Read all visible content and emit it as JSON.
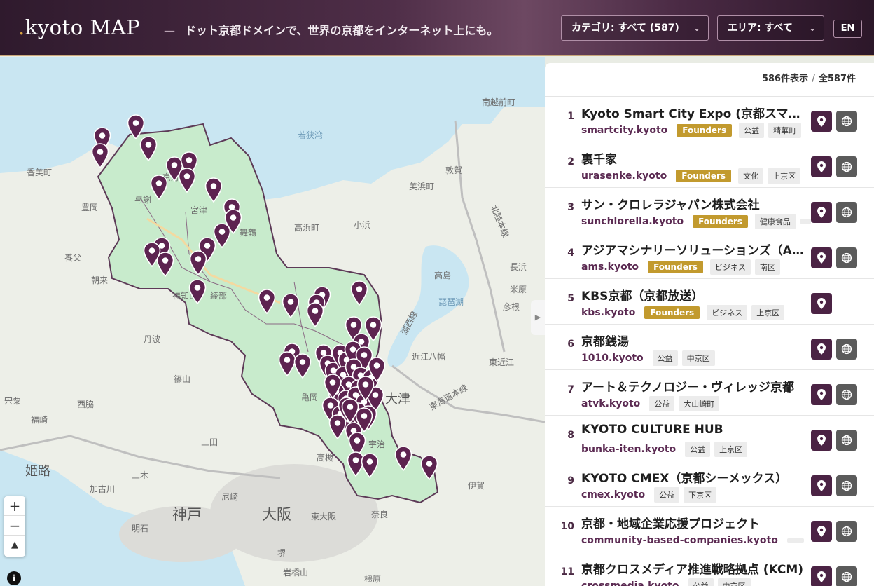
{
  "header": {
    "logo_dot": ".",
    "logo_text": "kyoto MAP",
    "dash": "—",
    "tagline": "ドット京都ドメインで、世界の京都をインターネット上にも。",
    "category_select": "カテゴリ: すべて (587)",
    "area_select": "エリア: すべて",
    "lang_button": "EN"
  },
  "map": {
    "labels": {
      "kasumi": "香美町",
      "toyooka": "豊岡",
      "yabu": "養父",
      "asago": "朝来",
      "tamba": "丹波",
      "sasayama": "篠山",
      "shiso": "宍粟",
      "nishiwaki": "西脇",
      "fukusaki": "福崎",
      "himeji": "姫路",
      "miki": "三木",
      "kakogawa": "加古川",
      "akashi": "明石",
      "kobe": "神戸",
      "sanda": "三田",
      "amagasaki": "尼崎",
      "osaka": "大阪",
      "higashiosaka": "東大阪",
      "nara": "奈良",
      "ikoma_mt": "岩橋山",
      "sakai": "堺",
      "kashihara": "橿原",
      "iga": "伊賀",
      "nagahama": "長浜",
      "takashima": "高島",
      "omihachiman": "近江八幡",
      "higashiomi": "東近江",
      "otsu": "大津",
      "hikone": "彦根",
      "maibara": "米原",
      "tsuruga": "敦賀",
      "mihama": "美浜町",
      "obama": "小浜",
      "takahama": "高浜町",
      "minamiechizen": "南越前町",
      "wakasa_bay": "若狭湾",
      "lake_biwa": "琵琶湖",
      "fukuchiyama": "福知山",
      "ayabe": "綾部",
      "maizuru": "舞鶴",
      "miyazu": "宮津",
      "kyotango": "京丹",
      "yosano": "与謝",
      "kameoka": "亀岡",
      "uji": "宇治",
      "takatsuki": "高槻",
      "kohoku": "北陸本線",
      "biwako_line": "湖西線",
      "tokaido": "東海道本線",
      "road_27": "27",
      "road_e8": "E8",
      "road_e95": "E95",
      "road_e26": "E26",
      "road_28": "28",
      "road_26": "26",
      "road_29": "29"
    },
    "zoom_in": "+",
    "zoom_out": "−",
    "compass": "▲",
    "info": "i",
    "collapse": "▶"
  },
  "panel": {
    "shown": "586件表示",
    "separator": "/",
    "total": "全587件",
    "items": [
      {
        "num": "1",
        "name": "Kyoto Smart City Expo (京都スマートシティエキスポ)",
        "domain": "smartcity.kyoto",
        "founders": "Founders",
        "tags": [
          "公益",
          "精華町"
        ],
        "web": true
      },
      {
        "num": "2",
        "name": "裏千家",
        "domain": "urasenke.kyoto",
        "founders": "Founders",
        "tags": [
          "文化",
          "上京区"
        ],
        "web": true
      },
      {
        "num": "3",
        "name": "サン・クロレラジャパン株式会社",
        "domain": "sunchlorella.kyoto",
        "founders": "Founders",
        "tags": [
          "健康食品",
          ""
        ],
        "web": true
      },
      {
        "num": "4",
        "name": "アジアマシナリーソリューションズ（AMS）",
        "domain": "ams.kyoto",
        "founders": "Founders",
        "tags": [
          "ビジネス",
          "南区"
        ],
        "web": true
      },
      {
        "num": "5",
        "name": "KBS京都（京都放送）",
        "domain": "kbs.kyoto",
        "founders": "Founders",
        "tags": [
          "ビジネス",
          "上京区"
        ],
        "web": false
      },
      {
        "num": "6",
        "name": "京都銭湯",
        "domain": "1010.kyoto",
        "founders": "",
        "tags": [
          "公益",
          "中京区"
        ],
        "web": true
      },
      {
        "num": "7",
        "name": "アート＆テクノロジー・ヴィレッジ京都",
        "domain": "atvk.kyoto",
        "founders": "",
        "tags": [
          "公益",
          "大山崎町"
        ],
        "web": true
      },
      {
        "num": "8",
        "name": "KYOTO CULTURE HUB",
        "domain": "bunka-iten.kyoto",
        "founders": "",
        "tags": [
          "公益",
          "上京区"
        ],
        "web": true
      },
      {
        "num": "9",
        "name": "KYOTO CMEX（京都シーメックス）",
        "domain": "cmex.kyoto",
        "founders": "",
        "tags": [
          "公益",
          "下京区"
        ],
        "web": true
      },
      {
        "num": "10",
        "name": "京都・地域企業応援プロジェクト",
        "domain": "community-based-companies.kyoto",
        "founders": "",
        "tags": [
          ""
        ],
        "web": true
      },
      {
        "num": "11",
        "name": "京都クロスメディア推進戦略拠点 (KCM)",
        "domain": "crossmedia.kyoto",
        "founders": "",
        "tags": [
          "公益",
          "中京区"
        ],
        "web": true
      }
    ]
  },
  "colors": {
    "brand": "#4b2344",
    "founders": "#c29a2e",
    "region": "#c8ebcc",
    "water": "#c9e6f2",
    "pin": "#5d2350"
  }
}
